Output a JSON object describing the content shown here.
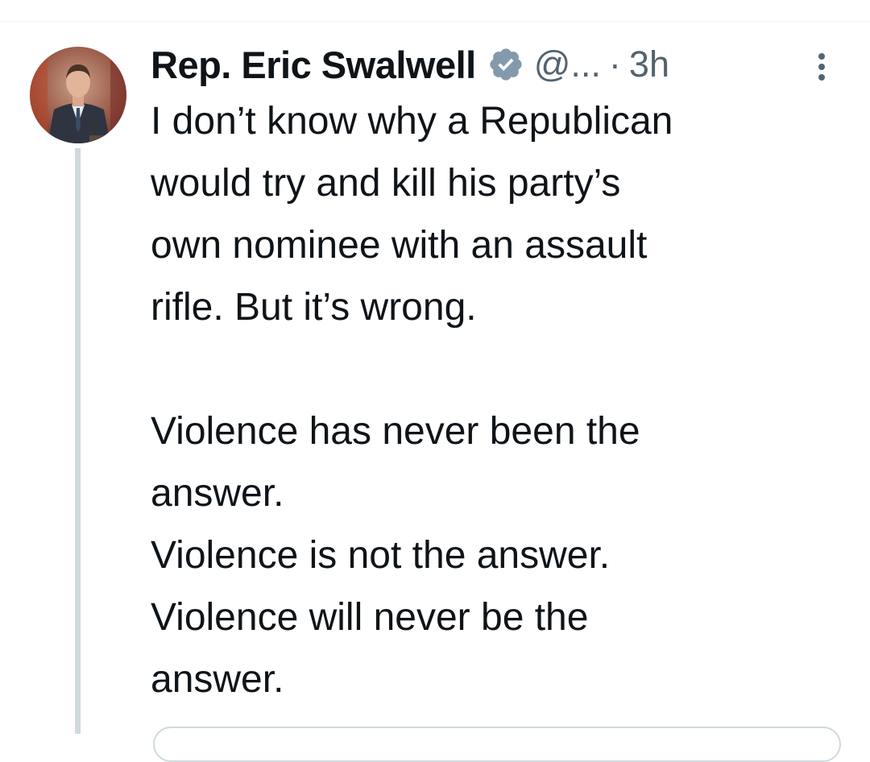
{
  "author": {
    "display_name": "Rep. Eric Swalwell",
    "handle": "@...",
    "separator": "·",
    "timestamp": "3h"
  },
  "icons": {
    "verified": "verified-badge-icon",
    "more": "more-options-icon",
    "avatar": "profile-photo"
  },
  "colors": {
    "text": "#0f1419",
    "secondary": "#536471",
    "verified_badge": "#829aab",
    "thread_line": "#cfd9de"
  },
  "tweet": {
    "text": "I don’t know why a Republican\nwould try and kill his party’s\nown nominee with an assault\nrifle. But it’s wrong.\n\nViolence has never been the\nanswer.\nViolence is not the answer.\nViolence will never be the\nanswer."
  }
}
